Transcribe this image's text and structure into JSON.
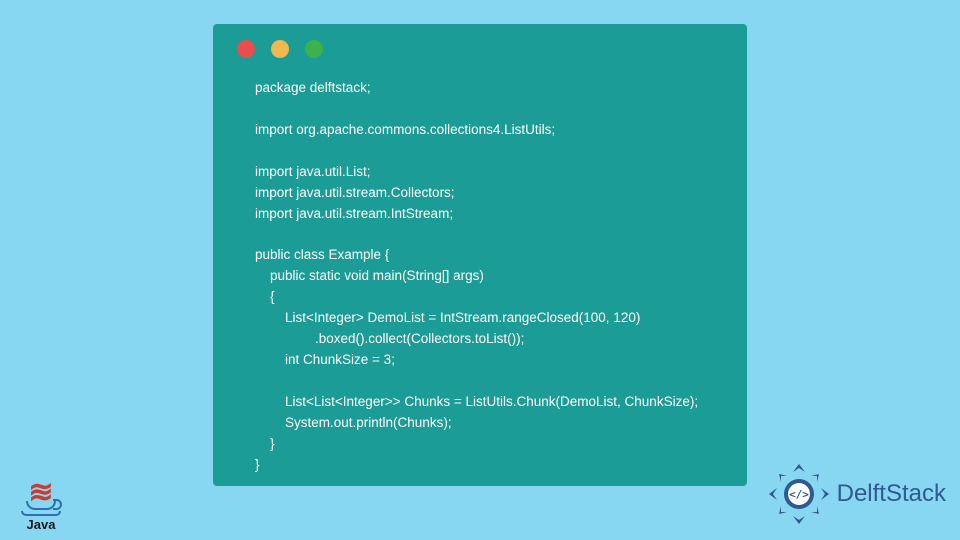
{
  "colors": {
    "background": "#87d6f2",
    "window": "#1b9c96",
    "code_text": "#ffffff",
    "dot_red": "#e84e4e",
    "dot_yellow": "#f0b84e",
    "dot_green": "#3bb34a",
    "java_steam": "#cc3b2e",
    "java_cup": "#2e6fb0",
    "delft_blue": "#2e5a8f"
  },
  "window": {
    "dots": [
      "close-dot",
      "minimize-dot",
      "maximize-dot"
    ]
  },
  "code": {
    "lines": [
      "package delftstack;",
      "",
      "import org.apache.commons.collections4.ListUtils;",
      "",
      "import java.util.List;",
      "import java.util.stream.Collectors;",
      "import java.util.stream.IntStream;",
      "",
      "public class Example {",
      "    public static void main(String[] args)",
      "    {",
      "        List<Integer> DemoList = IntStream.rangeClosed(100, 120)",
      "                .boxed().collect(Collectors.toList());",
      "        int ChunkSize = 3;",
      "",
      "        List<List<Integer>> Chunks = ListUtils.Chunk(DemoList, ChunkSize);",
      "        System.out.println(Chunks);",
      "    }",
      "}"
    ]
  },
  "java_logo": {
    "text": "Java"
  },
  "delft_logo": {
    "text": "DelftStack",
    "badge_symbol": "</>"
  }
}
